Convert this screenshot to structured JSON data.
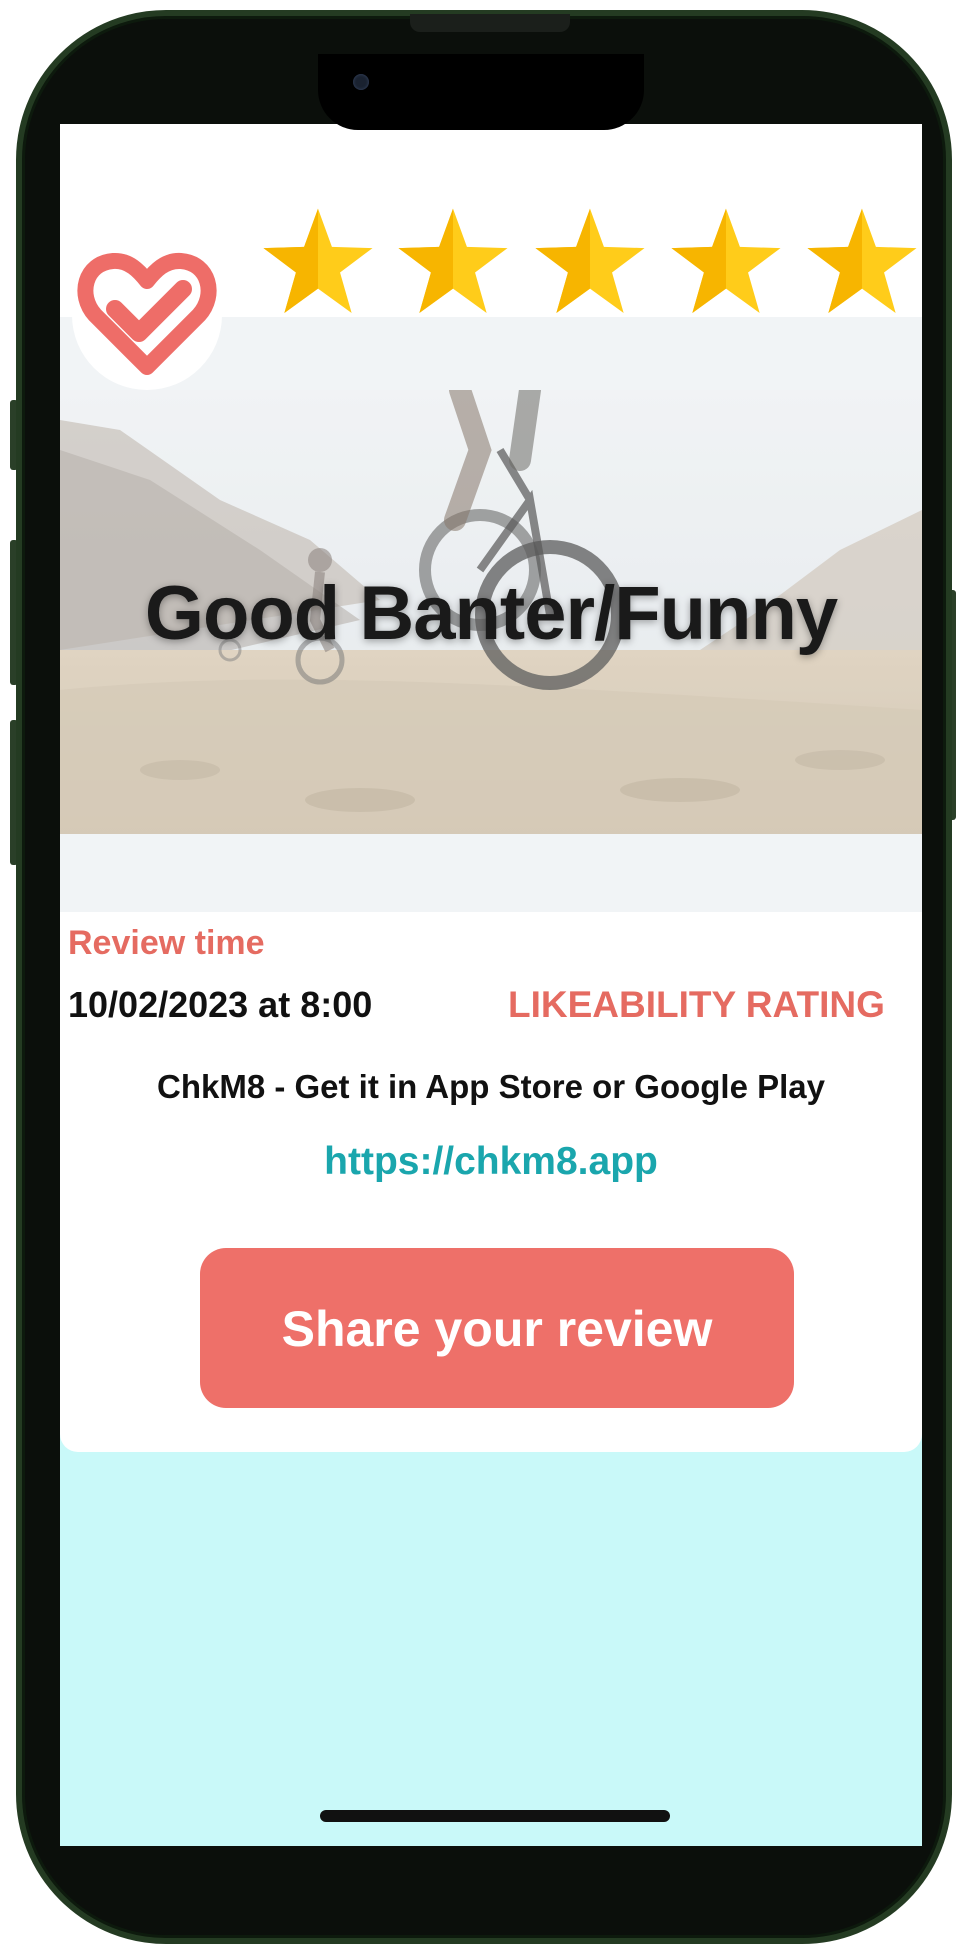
{
  "colors": {
    "accent": "#ee7069",
    "label_red": "#e56b61",
    "link_teal": "#1aa6ad",
    "screen_bg": "#c9f9f9",
    "star_yellow": "#ffcc1a",
    "phone_frame": "#243b22"
  },
  "header": {
    "badge_icon": "heart-check-icon",
    "rating": {
      "stars": 5,
      "max": 5,
      "icon": "star-icon"
    }
  },
  "banner": {
    "title": "Good Banter/Funny",
    "image": "mountain-biking-photo"
  },
  "review": {
    "time_label": "Review time",
    "time_value": "10/02/2023 at 8:00",
    "rating_label": "LIKEABILITY RATING"
  },
  "promo": {
    "text": "ChkM8 - Get it in App Store or Google Play",
    "link": "https://chkm8.app"
  },
  "actions": {
    "share_label": "Share your review"
  }
}
